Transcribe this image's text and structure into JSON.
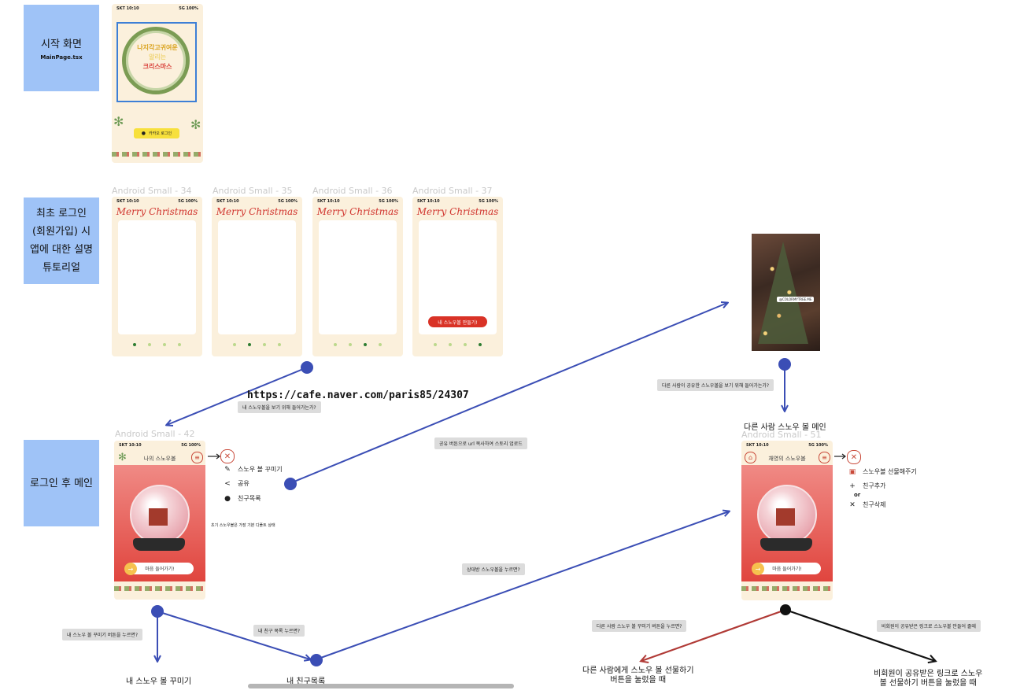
{
  "sections": {
    "start": {
      "label": "시작 화면",
      "file": "MainPage.tsx"
    },
    "first_login": {
      "line1": "최초 로그인",
      "line2": "(회원가입) 시",
      "line3": "앱에 대한 설명",
      "line4": "튜토리얼"
    },
    "after_login": {
      "label": "로그인 후 메인"
    }
  },
  "status_bar": {
    "carrier": "SKT 10:10",
    "signal": "5G 100%"
  },
  "start_screen": {
    "wreath_line1": "나지각고귀여운",
    "wreath_line2": "알리는",
    "wreath_line3": "크리스마스",
    "kakao_button": "카카오 로그인"
  },
  "tutorial": {
    "frames": [
      "Android Small - 34",
      "Android Small - 35",
      "Android Small - 36",
      "Android Small - 37"
    ],
    "heading": "Merry Christmas",
    "make_button": "내 스노우볼 만들기!"
  },
  "url": "https://cafe.naver.com/paris85/24307",
  "notes": {
    "view_my_ball": "내 스노우볼을 보기 위해 들어가는가?",
    "share_upload": "공유 버튼으로 url 복사하여 스토리 업로드",
    "view_other_ball": "다른 사람이 공유한 스노우볼을 보기 위해 들어가는가?",
    "decorate_click": "내 스노우 볼 꾸미기 버튼을 누르면?",
    "friend_list_click": "내 친구 목록 누르면?",
    "other_ball_click": "상대방 스노우볼을 누르면?",
    "gift_click": "다른 사람 스노우 볼 꾸미기 버튼을 누르면?",
    "nonmember_click": "비회원이 공유받은 링크로 스노우볼 만들어 줄때"
  },
  "my_main": {
    "frame": "Android Small - 42",
    "title": "나의 스노우볼",
    "menu": [
      "스노우 볼 꾸미기",
      "공유",
      "친구목록"
    ],
    "default_state": "초기 스노우볼은 가장 기본 디폴트 상태",
    "enter_button": "마음 들어가기!"
  },
  "story": {
    "tag": "@COLORMYTREE.ME"
  },
  "other_main": {
    "frame_title": "다른 사람 스노우 볼 메인",
    "frame": "Android Small - 51",
    "title": "채영의 스노우볼",
    "menu": [
      "스노우볼 선물해주기",
      "친구추가",
      "or",
      "친구삭제"
    ],
    "enter_button": "마음 들어가기!"
  },
  "destinations": {
    "decorate": "내 스노우 볼 꾸미기",
    "friend_list": "내 친구목록",
    "gift_line1": "다른 사람에게 스노우 볼 선물하기",
    "gift_line2": "버튼을 눌렀을 때",
    "nonmember_line1": "비회원이 공유받은 링크로 스노우",
    "nonmember_line2": "볼 선물하기 버튼을 눌렀을 때"
  },
  "colors": {
    "section": "#9fc3f7",
    "flow": "#3b4eb5",
    "gift_arrow": "#b03a36",
    "cream": "#fbf0dc"
  }
}
